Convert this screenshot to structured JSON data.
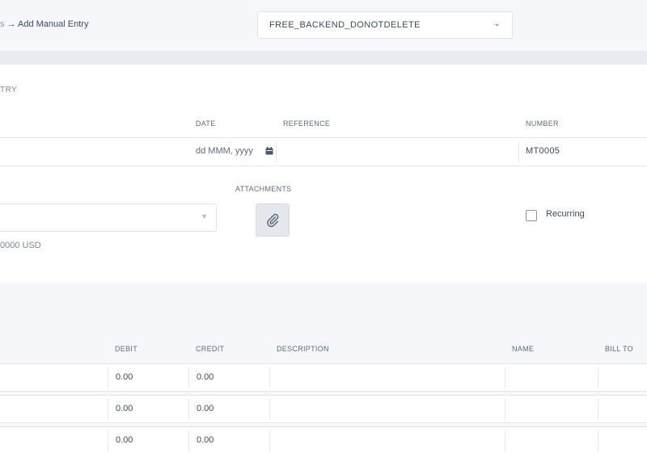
{
  "header": {
    "breadcrumb_prev": "s",
    "breadcrumb_sep": "→",
    "breadcrumb_current": "Add Manual Entry",
    "organization": "FREE_BACKEND_DONOTDELETE"
  },
  "form": {
    "section_title": "TRY",
    "date_label": "DATE",
    "date_placeholder": "dd MMM, yyyy",
    "reference_label": "REFERENCE",
    "number_label": "NUMBER",
    "number_value": "MT0005",
    "attachments_label": "ATTACHMENTS",
    "recurring_label": "Recurring",
    "currency_note": "0000 USD"
  },
  "lines": {
    "columns": {
      "debit": "DEBIT",
      "credit": "CREDIT",
      "description": "DESCRIPTION",
      "name": "NAME",
      "bill_to": "BILL TO"
    },
    "rows": [
      {
        "debit": "0.00",
        "credit": "0.00"
      },
      {
        "debit": "0.00",
        "credit": "0.00"
      },
      {
        "debit": "0.00",
        "credit": "0.00"
      }
    ]
  },
  "icons": {
    "org_chevron": "chevron-down-icon",
    "calendar": "calendar-icon",
    "attachment": "paperclip-icon"
  },
  "colors": {
    "background": "#f5f7fa",
    "card": "#ffffff",
    "border": "#e1e5eb",
    "text": "#3d4a5c",
    "muted": "#7d8898"
  }
}
